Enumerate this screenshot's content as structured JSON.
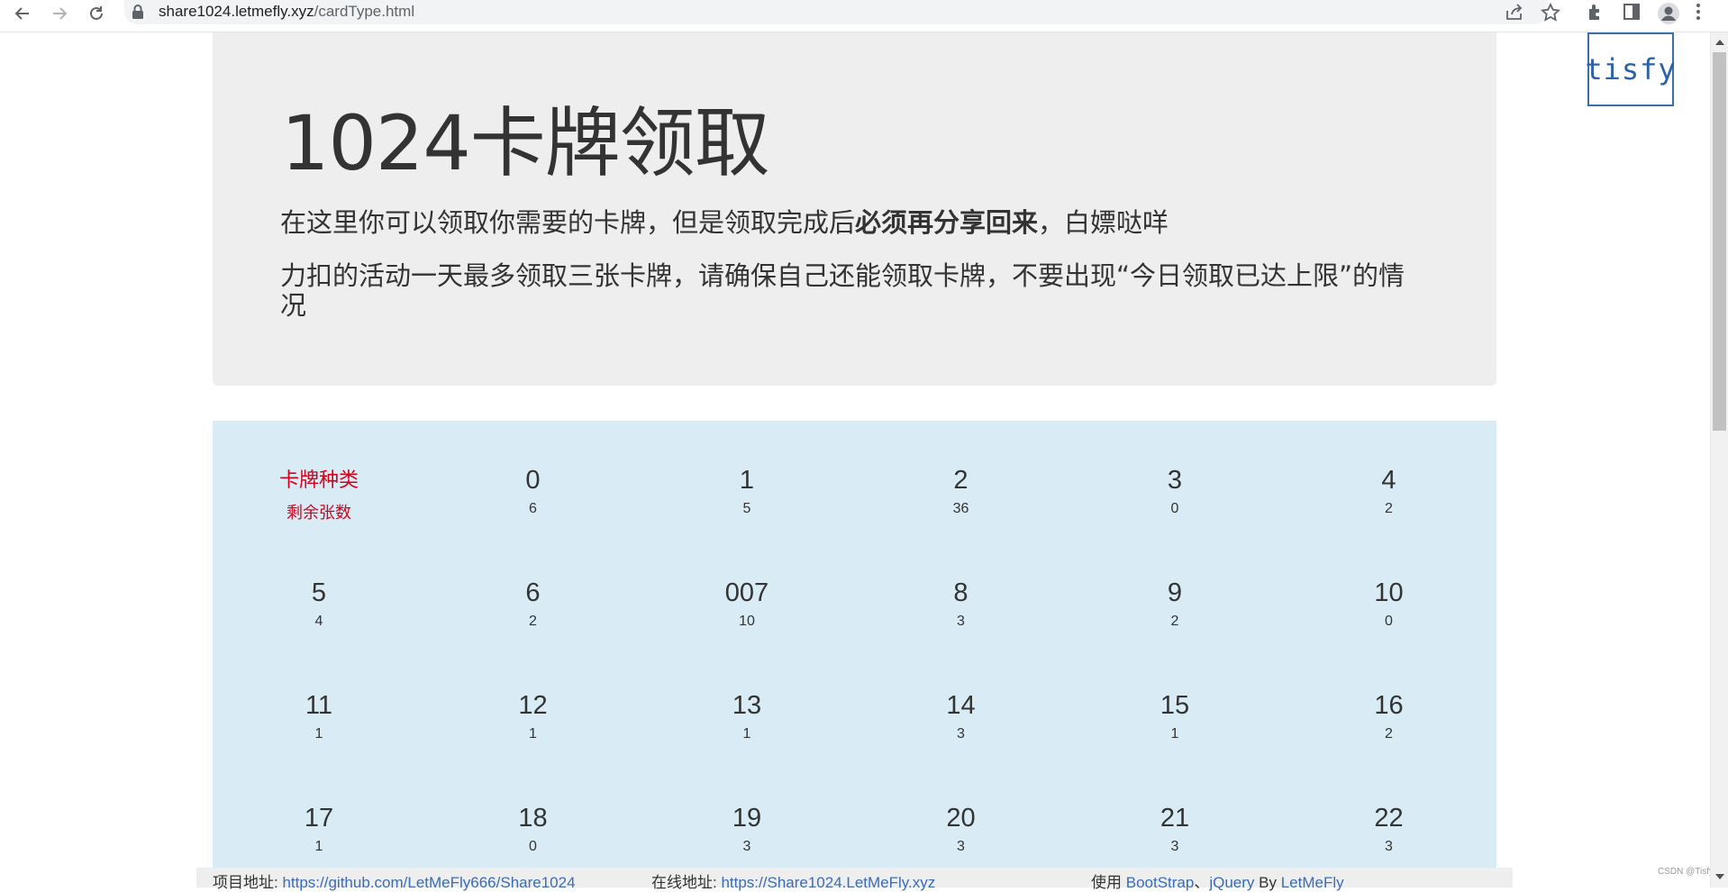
{
  "browser": {
    "url_host": "share1024.letmefly.xyz",
    "url_path": "/cardType.html"
  },
  "jumbotron": {
    "title": "1024卡牌领取",
    "line1_before": "在这里你可以领取你需要的卡牌，但是领取完成后",
    "line1_bold": "必须再分享回来",
    "line1_after": "，白嫖哒咩",
    "line2": "力扣的活动一天最多领取三张卡牌，请确保自己还能领取卡牌，不要出现“今日领取已达上限”的情况"
  },
  "logo": {
    "text": "tisfy"
  },
  "cards": {
    "header": {
      "type_label": "卡牌种类",
      "count_label": "剩余张数"
    },
    "items": [
      {
        "name": "0",
        "count": "6"
      },
      {
        "name": "1",
        "count": "5"
      },
      {
        "name": "2",
        "count": "36"
      },
      {
        "name": "3",
        "count": "0"
      },
      {
        "name": "4",
        "count": "2"
      },
      {
        "name": "5",
        "count": "4"
      },
      {
        "name": "6",
        "count": "2"
      },
      {
        "name": "007",
        "count": "10"
      },
      {
        "name": "8",
        "count": "3"
      },
      {
        "name": "9",
        "count": "2"
      },
      {
        "name": "10",
        "count": "0"
      },
      {
        "name": "11",
        "count": "1"
      },
      {
        "name": "12",
        "count": "1"
      },
      {
        "name": "13",
        "count": "1"
      },
      {
        "name": "14",
        "count": "3"
      },
      {
        "name": "15",
        "count": "1"
      },
      {
        "name": "16",
        "count": "2"
      },
      {
        "name": "17",
        "count": "1"
      },
      {
        "name": "18",
        "count": "0"
      },
      {
        "name": "19",
        "count": "3"
      },
      {
        "name": "20",
        "count": "3"
      },
      {
        "name": "21",
        "count": "3"
      },
      {
        "name": "22",
        "count": "3"
      }
    ]
  },
  "footer": {
    "project_label": "项目地址: ",
    "project_link": "https://github.com/LetMeFly666/Share1024",
    "online_label": "在线地址: ",
    "online_link": "https://Share1024.LetMeFly.xyz",
    "using_label": "使用 ",
    "bootstrap": "BootStrap",
    "sep": "、",
    "jquery": "jQuery",
    "by": " By ",
    "author": "LetMeFly"
  },
  "watermark": "CSDN @Tisfy"
}
